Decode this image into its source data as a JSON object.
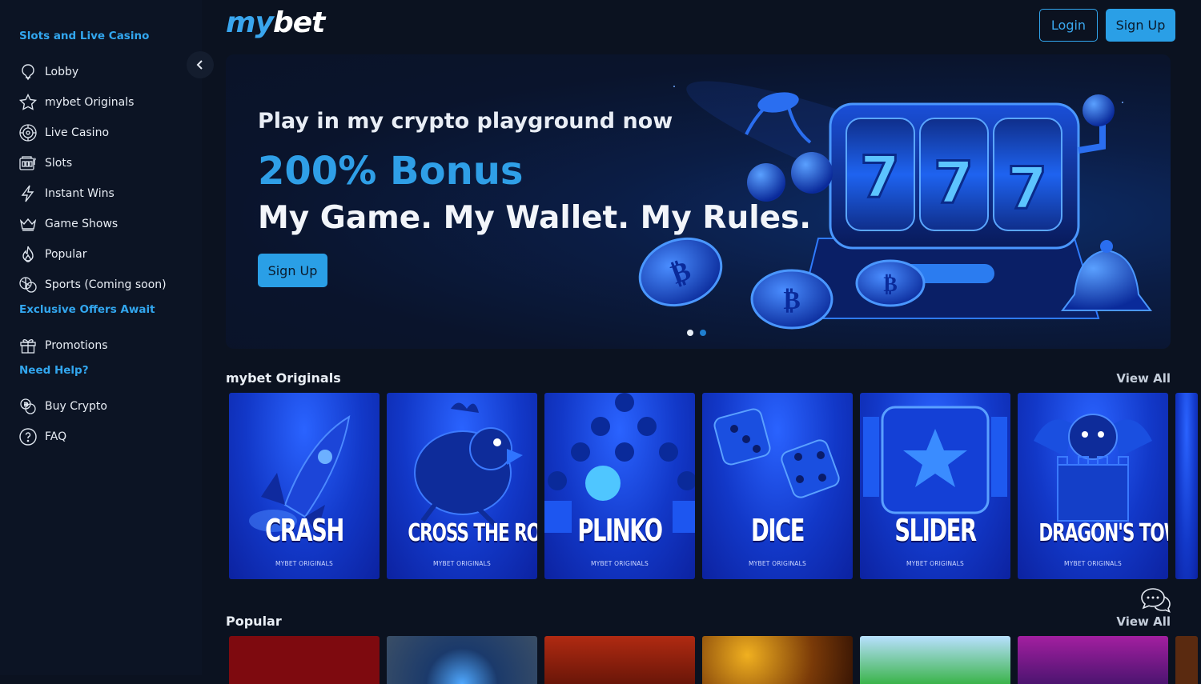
{
  "header": {
    "logo_my": "my",
    "logo_bet": "bet",
    "login_label": "Login",
    "signup_label": "Sign Up"
  },
  "sidebar": {
    "section1": "Slots and Live Casino",
    "items": [
      {
        "label": "Lobby",
        "icon": "lobby-icon"
      },
      {
        "label": "mybet Originals",
        "icon": "star-icon"
      },
      {
        "label": "Live Casino",
        "icon": "roulette-icon"
      },
      {
        "label": "Slots",
        "icon": "slot-machine-icon"
      },
      {
        "label": "Instant Wins",
        "icon": "lightning-icon"
      },
      {
        "label": "Game Shows",
        "icon": "crown-icon"
      },
      {
        "label": "Popular",
        "icon": "flame-icon"
      },
      {
        "label": "Sports (Coming soon)",
        "icon": "sports-ball-icon"
      }
    ],
    "section2": "Exclusive Offers Await",
    "items2": [
      {
        "label": "Promotions",
        "icon": "gift-icon"
      }
    ],
    "section3": "Need Help?",
    "items3": [
      {
        "label": "Buy Crypto",
        "icon": "coins-icon"
      },
      {
        "label": "FAQ",
        "icon": "question-icon"
      }
    ]
  },
  "banner": {
    "tagline": "Play in my crypto playground now",
    "bonus": "200% Bonus",
    "slogan": "My Game. My Wallet. My Rules.",
    "signup_label": "Sign Up",
    "slides_total": 2,
    "active_slide": 1
  },
  "originals": {
    "title": "mybet Originals",
    "view_all": "View All",
    "games": [
      {
        "name": "CRASH",
        "sub": "MYBET ORIGINALS"
      },
      {
        "name": "CROSS THE ROAD",
        "sub": "MYBET ORIGINALS"
      },
      {
        "name": "PLINKO",
        "sub": "MYBET ORIGINALS"
      },
      {
        "name": "DICE",
        "sub": "MYBET ORIGINALS"
      },
      {
        "name": "SLIDER",
        "sub": "MYBET ORIGINALS"
      },
      {
        "name": "DRAGON'S TOWER",
        "sub": "MYBET ORIGINALS"
      }
    ]
  },
  "popular": {
    "title": "Popular",
    "view_all": "View All"
  },
  "colors": {
    "accent": "#2a9fe6",
    "background": "#0b1220",
    "sidebar": "#0c1424",
    "card_blue": "#1238c8"
  }
}
